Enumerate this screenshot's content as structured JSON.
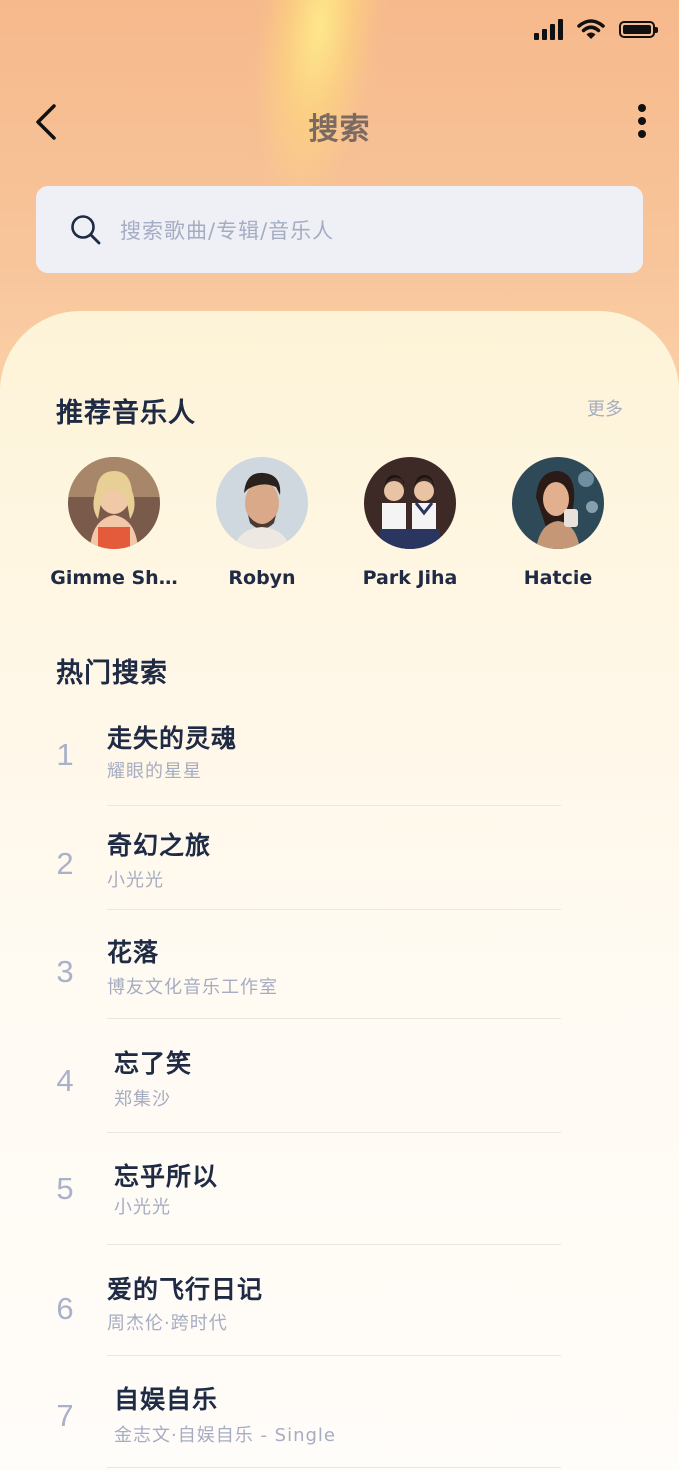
{
  "status": {
    "signal": "signal-icon",
    "wifi": "wifi-icon",
    "battery": "battery-icon"
  },
  "header": {
    "title": "搜索"
  },
  "search": {
    "placeholder": "搜索歌曲/专辑/音乐人"
  },
  "recommended": {
    "title": "推荐音乐人",
    "more": "更多",
    "artists": [
      {
        "name": "Gimme Sh…"
      },
      {
        "name": "Robyn"
      },
      {
        "name": "Park Jiha"
      },
      {
        "name": "Hatcie"
      }
    ]
  },
  "hot": {
    "title": "热门搜索",
    "items": [
      {
        "rank": "1",
        "song": "走失的灵魂",
        "artist": "耀眼的星星"
      },
      {
        "rank": "2",
        "song": "奇幻之旅",
        "artist": "小光光"
      },
      {
        "rank": "3",
        "song": "花落",
        "artist": "博友文化音乐工作室"
      },
      {
        "rank": "4",
        "song": "忘了笑",
        "artist": "郑集沙"
      },
      {
        "rank": "5",
        "song": "忘乎所以",
        "artist": "小光光"
      },
      {
        "rank": "6",
        "song": "爱的飞行日记",
        "artist": "周杰伦·跨时代"
      },
      {
        "rank": "7",
        "song": "自娱自乐",
        "artist": "金志文·自娱自乐 - Single"
      }
    ]
  }
}
